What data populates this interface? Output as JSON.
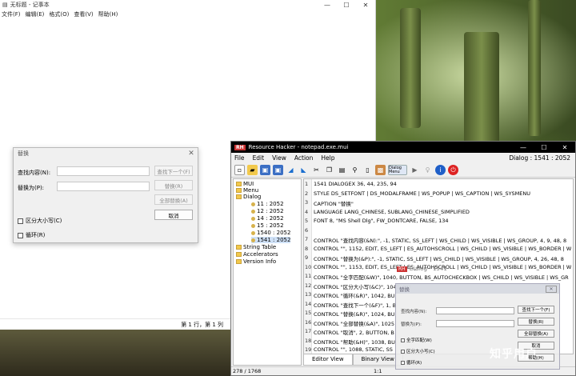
{
  "notepad": {
    "title": "无标题 - 记事本",
    "controls": [
      "—",
      "☐",
      "✕"
    ],
    "menu": [
      "文件(F)",
      "编辑(E)",
      "格式(O)",
      "查看(V)",
      "帮助(H)"
    ],
    "status": "第 1 行，第 1 列"
  },
  "replace": {
    "title": "替换",
    "find_label": "查找内容(N):",
    "replace_label": "替换为(P):",
    "buttons": [
      "查找下一个(F)",
      "替换(R)",
      "全部替换(A)",
      "取消"
    ],
    "match_case": "区分大小写(C)",
    "wrap": "循环(R)"
  },
  "rh": {
    "title": "Resource Hacker - notepad.exe.mui",
    "logo": "RH",
    "controls": [
      "—",
      "☐",
      "✕"
    ],
    "menu": [
      "File",
      "Edit",
      "View",
      "Action",
      "Help"
    ],
    "menu_right": "Dialog : 1541 : 2052",
    "toolbar_dialog_menu": "Dialog Menu",
    "tree": {
      "mui": "MUI",
      "menu": "Menu",
      "dialog": "Dialog",
      "items": [
        "11 : 2052",
        "12 : 2052",
        "14 : 2052",
        "15 : 2052",
        "1540 : 2052",
        "1541 : 2052"
      ],
      "string_table": "String Table",
      "accelerators": "Accelerators",
      "version_info": "Version Info"
    },
    "code_lines": [
      "1541 DIALOGEX 36, 44, 235, 94",
      "STYLE DS_SETFONT | DS_MODALFRAME | WS_POPUP | WS_CAPTION | WS_SYSMENU",
      "CAPTION \"替换\"",
      "LANGUAGE LANG_CHINESE, SUBLANG_CHINESE_SIMPLIFIED",
      "FONT 8, \"MS Shell Dlg\", FW_DONTCARE, FALSE, 134",
      "",
      "  CONTROL \"查找内容(&N):\", -1, STATIC, SS_LEFT | WS_CHILD | WS_VISIBLE | WS_GROUP, 4, 9, 48, 8",
      "  CONTROL \"\", 1152, EDIT, ES_LEFT | ES_AUTOHSCROLL | WS_CHILD | WS_VISIBLE | WS_BORDER | W",
      "  CONTROL \"替换为(&P):\", -1, STATIC, SS_LEFT | WS_CHILD | WS_VISIBLE | WS_GROUP, 4, 26, 48, 8",
      "  CONTROL \"\", 1153, EDIT, ES_LEFT | ES_AUTOHSCROLL | WS_CHILD | WS_VISIBLE | WS_BORDER | W",
      "  CONTROL \"全字匹配(&W)\", 1040, BUTTON, BS_AUTOCHECKBOX | WS_CHILD | WS_VISIBLE | WS_GR",
      "  CONTROL \"区分大小写(&C)\", 1041, BU",
      "  CONTROL \"循环(&R)\", 1042, BU",
      "  CONTROL \"查找下一个(&F)\", 1, B",
      "  CONTROL \"替换(&R)\", 1024, BU",
      "  CONTROL \"全部替换(&A)\", 1025",
      "  CONTROL \"取消\", 2, BUTTON, B",
      "  CONTROL \"帮助(&H)\", 1038, BU",
      "  CONTROL \"\", 1088, STATIC, SS"
    ],
    "line_numbers": [
      "1",
      "2",
      "3",
      "4",
      "5",
      "6",
      "7",
      "8",
      "9",
      "10",
      "11",
      "12",
      "13",
      "14",
      "15",
      "16",
      "17",
      "18",
      "19"
    ],
    "tabs": [
      "Editor View",
      "Binary View"
    ],
    "status_left": "278 / 1768",
    "status_mid": "1:1"
  },
  "floating_label": "Dialog - 1541",
  "preview": {
    "title": "替换",
    "find_label": "查找内容(N):",
    "replace_label": "替换为(P):",
    "buttons": [
      "查找下一个(F)",
      "替换(R)",
      "全部替换(A)",
      "取消",
      "帮助(H)"
    ],
    "whole_word": "全字匹配(W)",
    "match_case": "区分大小写(C)",
    "wrap": "循环(R)"
  },
  "watermark": "知乎用户"
}
